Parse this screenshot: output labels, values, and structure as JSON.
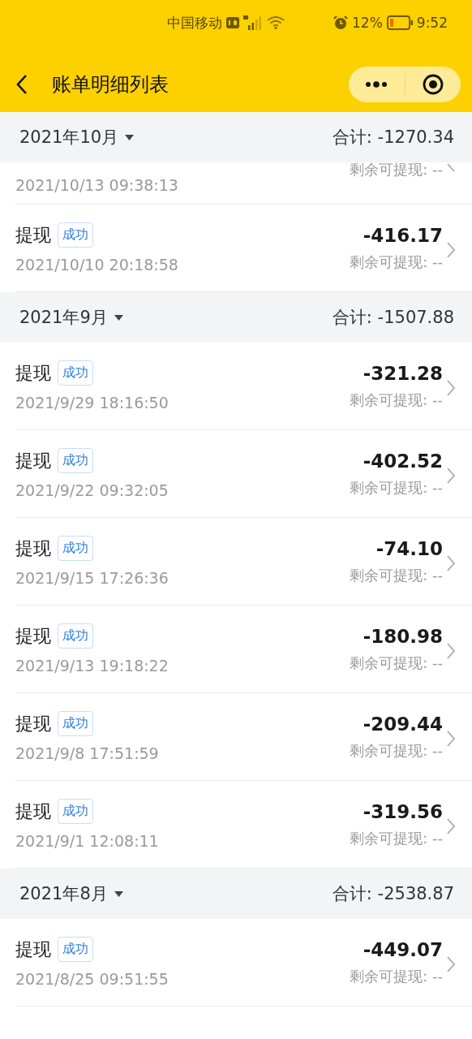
{
  "status_bar": {
    "carrier": "中国移动",
    "battery": "12%",
    "time": "9:52"
  },
  "nav": {
    "title": "账单明细列表"
  },
  "months": [
    {
      "month": "2021年10月",
      "total": "合计: -1270.34",
      "items": [
        {
          "kind": "partial",
          "date": "2021/10/13 09:38:13",
          "balance": "剩余可提现: --"
        },
        {
          "kind": "full",
          "title": "提现",
          "status": "成功",
          "amount": "-416.17",
          "date": "2021/10/10 20:18:58",
          "balance": "剩余可提现: --"
        }
      ]
    },
    {
      "month": "2021年9月",
      "total": "合计: -1507.88",
      "items": [
        {
          "kind": "full",
          "title": "提现",
          "status": "成功",
          "amount": "-321.28",
          "date": "2021/9/29 18:16:50",
          "balance": "剩余可提现: --"
        },
        {
          "kind": "full",
          "title": "提现",
          "status": "成功",
          "amount": "-402.52",
          "date": "2021/9/22 09:32:05",
          "balance": "剩余可提现: --"
        },
        {
          "kind": "full",
          "title": "提现",
          "status": "成功",
          "amount": "-74.10",
          "date": "2021/9/15 17:26:36",
          "balance": "剩余可提现: --"
        },
        {
          "kind": "full",
          "title": "提现",
          "status": "成功",
          "amount": "-180.98",
          "date": "2021/9/13 19:18:22",
          "balance": "剩余可提现: --"
        },
        {
          "kind": "full",
          "title": "提现",
          "status": "成功",
          "amount": "-209.44",
          "date": "2021/9/8 17:51:59",
          "balance": "剩余可提现: --"
        },
        {
          "kind": "full",
          "title": "提现",
          "status": "成功",
          "amount": "-319.56",
          "date": "2021/9/1 12:08:11",
          "balance": "剩余可提现: --"
        }
      ]
    },
    {
      "month": "2021年8月",
      "total": "合计: -2538.87",
      "items": [
        {
          "kind": "full",
          "title": "提现",
          "status": "成功",
          "amount": "-449.07",
          "date": "2021/8/25 09:51:55",
          "balance": "剩余可提现: --"
        }
      ]
    }
  ]
}
